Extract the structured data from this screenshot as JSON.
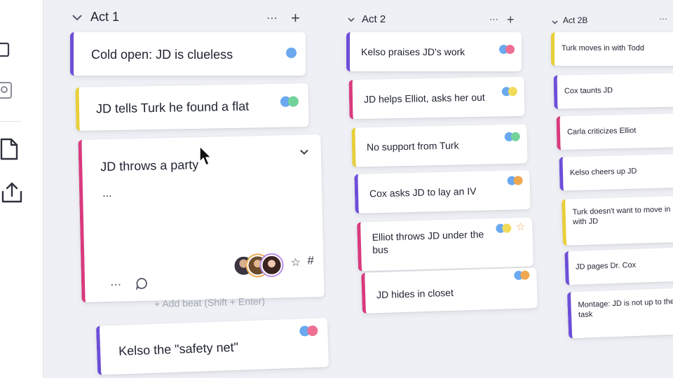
{
  "colors": {
    "purple": "#6d4fd8",
    "yellow": "#e8cf3a",
    "pink": "#d93a7e",
    "dot_blue": "#6aa9f0",
    "dot_green": "#72d39a",
    "dot_pink": "#ee6f92",
    "dot_yellow": "#f0dc5a",
    "dot_orange": "#f0a84f"
  },
  "sidebar": {
    "icons": [
      "copy-icon",
      "user-search-icon",
      "document-icon",
      "share-icon"
    ]
  },
  "columns": [
    {
      "title": "Act 1",
      "actions": [
        "more-icon",
        "plus-icon"
      ],
      "add_beat_label": "+ Add beat (Shift + Enter)",
      "cards": [
        {
          "title": "Cold open: JD is clueless",
          "color": "purple",
          "dots": [
            "blue"
          ]
        },
        {
          "title": "JD tells Turk he found a flat",
          "color": "yellow",
          "dots": [
            "blue",
            "green"
          ]
        },
        {
          "title": "JD throws a party",
          "color": "pink",
          "expanded": true,
          "placeholder": "...",
          "dots": []
        },
        {
          "title": "Kelso the \"safety net\"",
          "color": "purple",
          "dots": [
            "blue",
            "pink"
          ]
        }
      ]
    },
    {
      "title": "Act 2",
      "actions": [
        "more-icon",
        "plus-icon"
      ],
      "cards": [
        {
          "title": "Kelso praises JD's work",
          "color": "purple",
          "dots": [
            "blue",
            "pink"
          ]
        },
        {
          "title": "JD helps Elliot, asks her out",
          "color": "pink",
          "dots": [
            "blue",
            "yellow"
          ]
        },
        {
          "title": "No support from Turk",
          "color": "yellow",
          "dots": [
            "blue",
            "green"
          ]
        },
        {
          "title": "Cox asks JD to lay an IV",
          "color": "purple",
          "dots": [
            "blue",
            "orange"
          ]
        },
        {
          "title": "Elliot throws JD under the bus",
          "color": "pink",
          "dots": [
            "blue",
            "yellow"
          ],
          "star": true
        },
        {
          "title": "JD hides in closet",
          "color": "pink",
          "dots": [
            "blue",
            "orange"
          ]
        }
      ]
    },
    {
      "title": "Act 2B",
      "actions": [
        "more-icon"
      ],
      "cards": [
        {
          "title": "Turk moves in with Todd",
          "color": "yellow"
        },
        {
          "title": "Cox taunts JD",
          "color": "purple"
        },
        {
          "title": "Carla criticizes Elliot",
          "color": "pink"
        },
        {
          "title": "Kelso cheers up JD",
          "color": "purple"
        },
        {
          "title": "Turk doesn't want to move in with JD",
          "color": "yellow"
        },
        {
          "title": "JD pages Dr. Cox",
          "color": "purple"
        },
        {
          "title": "Montage: JD is not up to the task",
          "color": "purple"
        }
      ]
    }
  ]
}
